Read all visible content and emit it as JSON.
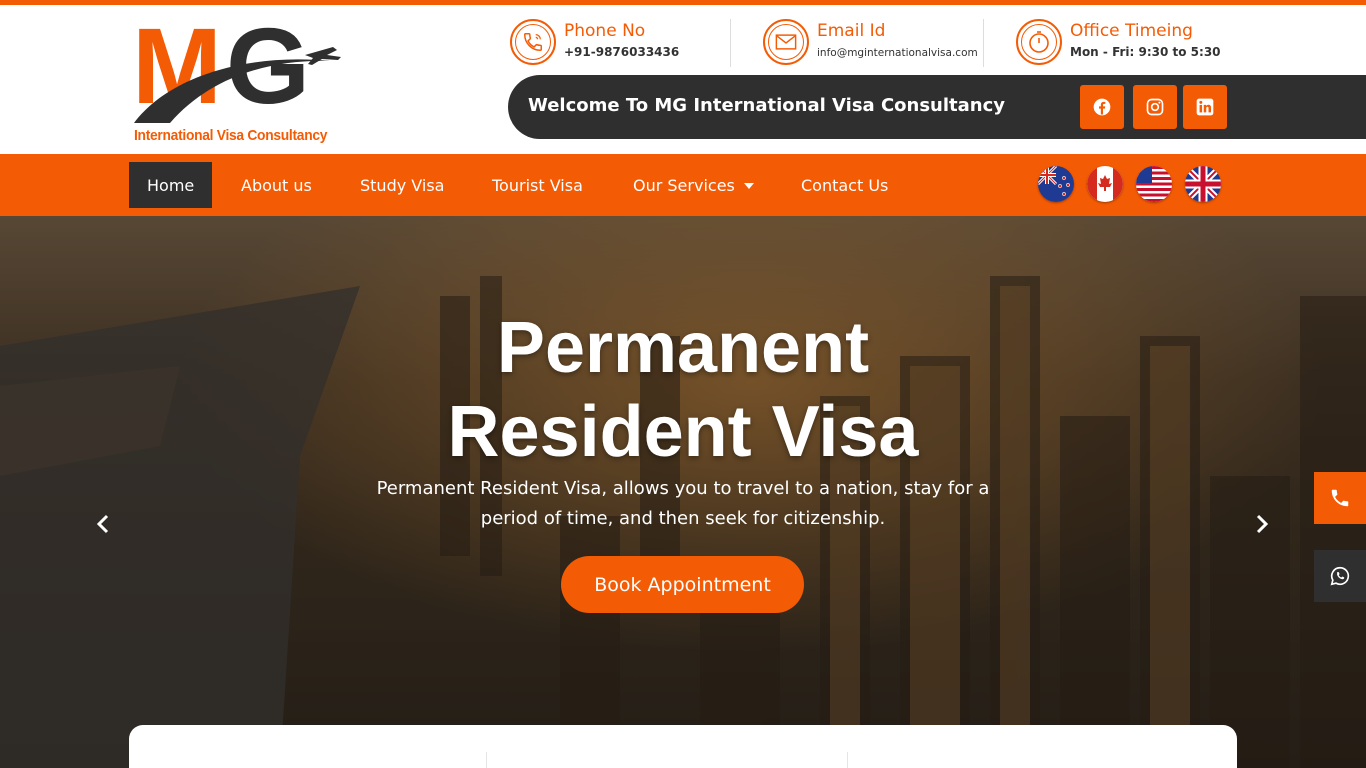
{
  "colors": {
    "accent": "#f45b05",
    "dark": "#2f2f2f",
    "white": "#ffffff"
  },
  "logo": {
    "letters": "MG",
    "subtitle": "International Visa Consultancy"
  },
  "contact": [
    {
      "icon": "phone-icon",
      "title": "Phone No",
      "text": "+91-9876033436"
    },
    {
      "icon": "envelope-icon",
      "title": "Email Id",
      "text": "info@mginternationalvisa.com"
    },
    {
      "icon": "clock-icon",
      "title": "Office Timeing",
      "text": "Mon - Fri: 9:30 to 5:30"
    }
  ],
  "welcome": "Welcome To MG International Visa Consultancy",
  "social": [
    "facebook-icon",
    "instagram-icon",
    "linkedin-icon"
  ],
  "nav": {
    "items": [
      "Home",
      "About us",
      "Study Visa",
      "Tourist Visa",
      "Our Services",
      "Contact Us"
    ],
    "active": "Home",
    "flags": [
      "new-zealand-flag-icon",
      "canada-flag-icon",
      "usa-flag-icon",
      "uk-flag-icon"
    ]
  },
  "hero": {
    "title_line1": "Permanent",
    "title_line2": "Resident Visa",
    "subtitle_line1": "Permanent Resident Visa, allows you to travel to a nation, stay for a",
    "subtitle_line2": "period of time, and then seek for citizenship.",
    "button": "Book Appointment"
  },
  "floating": [
    "phone-icon",
    "whatsapp-icon"
  ]
}
